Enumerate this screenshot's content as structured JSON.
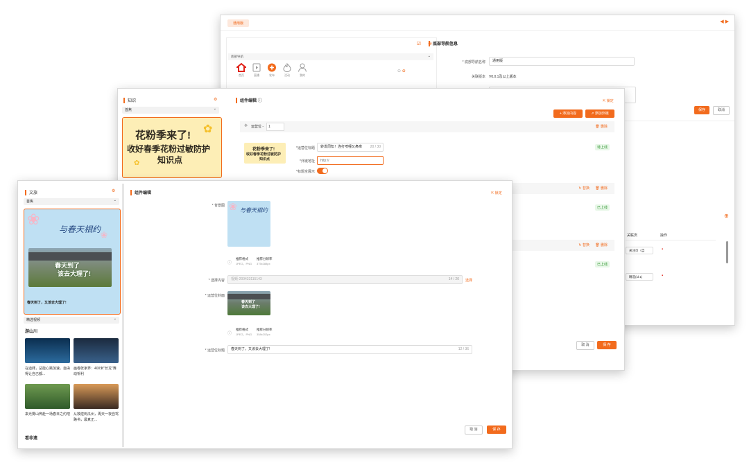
{
  "win_a": {
    "tab": "通用版",
    "left_header": "底部导航",
    "nav_items": [
      "首页",
      "直播",
      "发布",
      "活动",
      "我的"
    ],
    "section_title": "底部导航信息",
    "name_label": "* 底部导航名称",
    "name_value": "通用版",
    "version_label": "关联版本",
    "version_value": "V0.0.1及以上版本",
    "btn_save": "保存",
    "btn_cancel": "取消",
    "table_col1": "关联页",
    "table_col2": "操作",
    "row1_select": "关注页（自",
    "row2_select": "精选(id:1)"
  },
  "win_b": {
    "left_title": "知识",
    "left_select": "首焦",
    "banner_line1": "花粉季来了!",
    "banner_line2": "收好春季花粉过敏防护",
    "banner_line3": "知识点",
    "main_title": "组件编辑",
    "lock_label": "锁定",
    "btn_add_content": "+ 添加内容",
    "btn_add_link": "⇗ 添加外链",
    "position_label": "运营位 -",
    "position_value": "1",
    "delete_label": "删除",
    "replace_label": "替换",
    "card_title_label": "*运营位标题",
    "card_title_value": "转发周知！连打喷嚏又鼻痒",
    "card_title_count": "20 / 30",
    "link_label": "*外链地址",
    "link_placeholder": "http://",
    "show_title_label": "*标题全展示",
    "status_on": "待上线",
    "status_up": "已上线",
    "btn_cancel": "取 消",
    "btn_save": "保 存"
  },
  "win_c": {
    "left_title": "文旅",
    "left_select": "首焦",
    "banner_title": "与春天相约",
    "banner_sub1": "春天到了",
    "banner_sub2": "该去大理了!",
    "banner_caption": "春天到了，又该去大理了!",
    "select2": "精选视频",
    "section1": "游山川",
    "videos": [
      "在迪拜，总能心跳加速。自由得让自己都...",
      "画卷张家界：400米\"长龙\"舞动祈利",
      "来光雾山奔赴一场春日之约吧",
      "从敦煌到瓜州，再天一夜自驾路书，最真正..."
    ],
    "section2": "看非遗",
    "main_title": "组件编辑",
    "lock_label": "锁定",
    "bg_label": "* 背景图",
    "rec_format_label": "推荐格式",
    "rec_format_value": "JPEG、PNG",
    "rec_res_label": "推荐分辨率",
    "rec_res_value1": "375x288px",
    "select_content_label": "* 选择内容",
    "select_content_value": "视频-200433115143",
    "select_content_count": "14 / 20",
    "select_btn": "选择",
    "cover_label": "* 运营位封面",
    "rec_res_value2": "358x202px",
    "title_label": "* 运营位标题",
    "title_value": "春天到了，又该去大理了!",
    "title_count": "12 / 36",
    "btn_cancel": "取 消",
    "btn_save": "保 存"
  },
  "colors": {
    "accent": "#f26b1d",
    "success": "#3a9b3a"
  }
}
